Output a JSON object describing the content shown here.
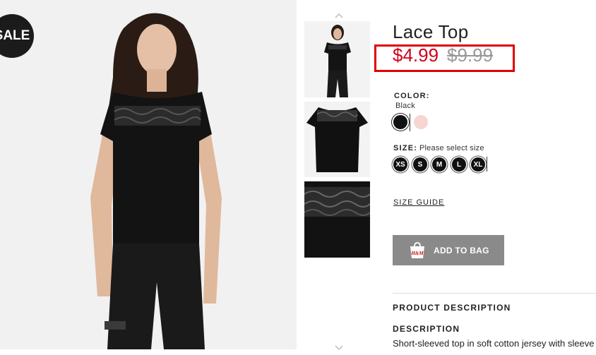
{
  "badge": {
    "sale": "SALE"
  },
  "product": {
    "title": "Lace Top",
    "price_sale": "$4.99",
    "price_original": "$9.99"
  },
  "color": {
    "label": "COLOR:",
    "selected": "Black",
    "swatches": [
      {
        "name": "Black",
        "hex": "#111111"
      },
      {
        "name": "Light pink",
        "hex": "#f6d6d2"
      }
    ]
  },
  "size": {
    "label": "SIZE:",
    "prompt": "Please select size",
    "options": [
      "XS",
      "S",
      "M",
      "L",
      "XL"
    ]
  },
  "links": {
    "size_guide": "SIZE GUIDE"
  },
  "cta": {
    "add_to_bag": "ADD TO BAG",
    "bag_brand": "H&M"
  },
  "sections": {
    "product_description": "PRODUCT DESCRIPTION",
    "description_heading": "DESCRIPTION",
    "description_text": "Short-sleeved top in soft cotton jersey with sleeve"
  },
  "colors": {
    "price_red": "#d0001a",
    "highlight_border": "#e10000",
    "button_gray": "#8a8a8a"
  }
}
